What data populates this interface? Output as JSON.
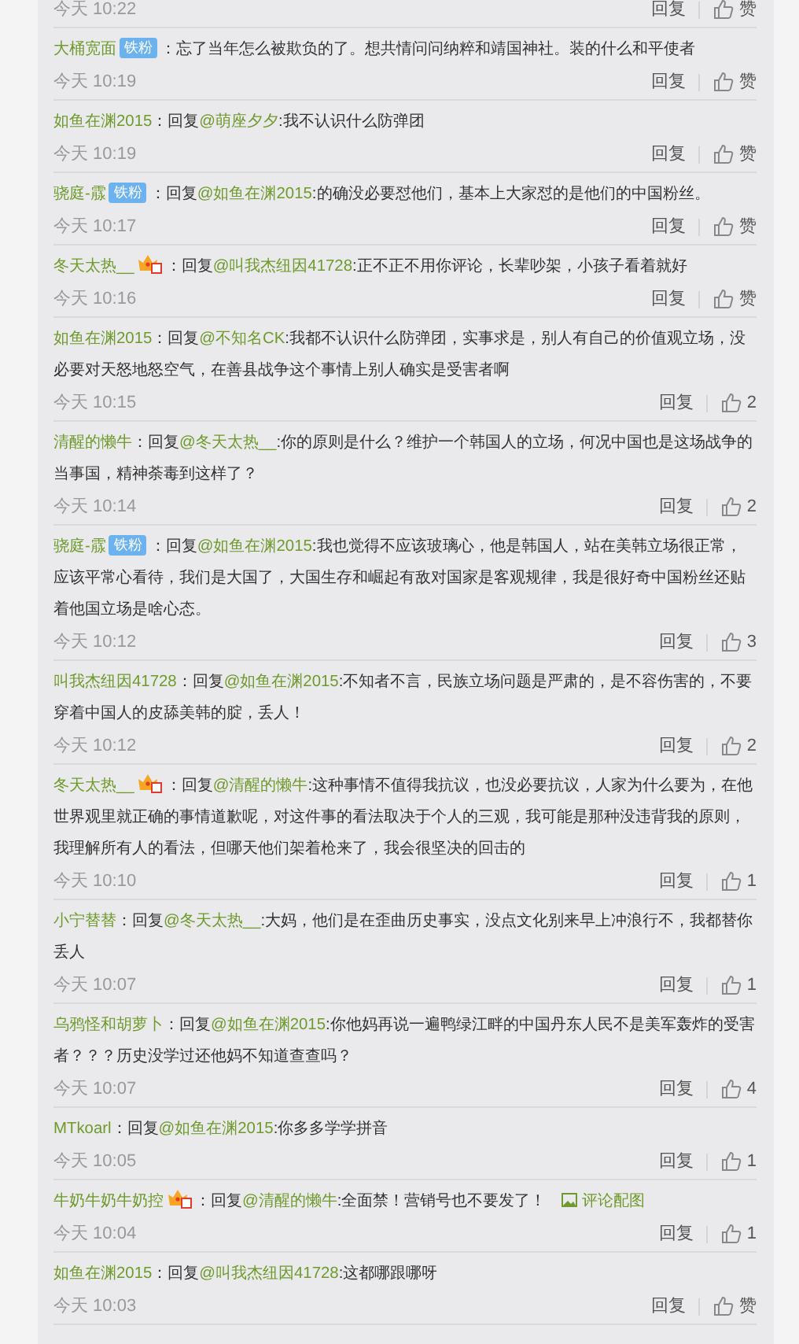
{
  "comments": [
    {
      "time": "今天 10:22",
      "reply": "回复",
      "likes": "赞"
    },
    {
      "user": "大桶宽面",
      "badge": {
        "kind": "fan",
        "text": "铁粉"
      },
      "colon": "：",
      "text": "忘了当年怎么被欺负的了。想共情问问纳粹和靖国神社。装的什么和平使者",
      "time": "今天 10:19",
      "reply": "回复",
      "likes": "赞"
    },
    {
      "user": "如鱼在渊2015",
      "colon": "：",
      "reply_label": "回复",
      "mention": "@萌座夕夕",
      "text": ":我不认识什么防弹团",
      "time": "今天 10:19",
      "reply": "回复",
      "likes": "赞"
    },
    {
      "user": "骁庭-霡",
      "badge": {
        "kind": "fan",
        "text": "铁粉"
      },
      "colon": "：",
      "reply_label": "回复",
      "mention": "@如鱼在渊2015",
      "text": ":的确没必要怼他们，基本上大家怼的是他们的中国粉丝。",
      "time": "今天 10:17",
      "reply": "回复",
      "likes": "赞"
    },
    {
      "user": "冬天太热__",
      "badge": {
        "kind": "crown"
      },
      "colon": "：",
      "reply_label": "回复",
      "mention": "@叫我杰纽因41728",
      "text": ":正不正不用你评论，长辈吵架，小孩子看着就好",
      "time": "今天 10:16",
      "reply": "回复",
      "likes": "赞"
    },
    {
      "user": "如鱼在渊2015",
      "colon": "：",
      "reply_label": "回复",
      "mention": "@不知名CK",
      "text": ":我都不认识什么防弹团，实事求是，别人有自己的价值观立场，没必要对天怒地怒空气，在善县战争这个事情上别人确实是受害者啊",
      "time": "今天 10:15",
      "reply": "回复",
      "likes": "2"
    },
    {
      "user": "清醒的懒牛",
      "colon": "：",
      "reply_label": "回复",
      "mention": "@冬天太热__",
      "text": ":你的原则是什么？维护一个韩国人的立场，何况中国也是这场战争的当事国，精神荼毒到这样了？",
      "time": "今天 10:14",
      "reply": "回复",
      "likes": "2"
    },
    {
      "user": "骁庭-霡",
      "badge": {
        "kind": "fan",
        "text": "铁粉"
      },
      "colon": "：",
      "reply_label": "回复",
      "mention": "@如鱼在渊2015",
      "text": ":我也觉得不应该玻璃心，他是韩国人，站在美韩立场很正常，应该平常心看待，我们是大国了，大国生存和崛起有敌对国家是客观规律，我是很好奇中国粉丝还贴着他国立场是啥心态。",
      "time": "今天 10:12",
      "reply": "回复",
      "likes": "3"
    },
    {
      "user": "叫我杰纽因41728",
      "colon": "：",
      "reply_label": "回复",
      "mention": "@如鱼在渊2015",
      "text": ":不知者不言，民族立场问题是严肃的，是不容伤害的，不要穿着中国人的皮舔美韩的腚，丢人！",
      "time": "今天 10:12",
      "reply": "回复",
      "likes": "2"
    },
    {
      "user": "冬天太热__",
      "badge": {
        "kind": "crown"
      },
      "colon": "：",
      "reply_label": "回复",
      "mention": "@清醒的懒牛",
      "text": ":这种事情不值得我抗议，也没必要抗议，人家为什么要为，在他世界观里就正确的事情道歉呢，对这件事的看法取决于个人的三观，我可能是那种没违背我的原则，我理解所有人的看法，但哪天他们架着枪来了，我会很坚决的回击的",
      "time": "今天 10:10",
      "reply": "回复",
      "likes": "1"
    },
    {
      "user": "小宁替替",
      "colon": "：",
      "reply_label": "回复",
      "mention": "@冬天太热__",
      "text": ":大妈，他们是在歪曲历史事实，没点文化别来早上冲浪行不，我都替你丢人",
      "time": "今天 10:07",
      "reply": "回复",
      "likes": "1"
    },
    {
      "user": "乌鸦怪和胡萝卜",
      "colon": "：",
      "reply_label": "回复",
      "mention": "@如鱼在渊2015",
      "text": ":你他妈再说一遍鸭绿江畔的中国丹东人民不是美军轰炸的受害者？？？历史没学过还他妈不知道查查吗？",
      "time": "今天 10:07",
      "reply": "回复",
      "likes": "4"
    },
    {
      "user": "MTkoarl",
      "colon": "：",
      "reply_label": "回复",
      "mention": "@如鱼在渊2015",
      "text": ":你多多学学拼音",
      "time": "今天 10:05",
      "reply": "回复",
      "likes": "1"
    },
    {
      "user": "牛奶牛奶牛奶控",
      "badge": {
        "kind": "crown"
      },
      "colon": "：",
      "reply_label": "回复",
      "mention": "@清醒的懒牛",
      "text": ":全面禁！营销号也不要发了！",
      "image_link": "评论配图",
      "time": "今天 10:04",
      "reply": "回复",
      "likes": "1"
    },
    {
      "user": "如鱼在渊2015",
      "colon": "：",
      "reply_label": "回复",
      "mention": "@叫我杰纽因41728",
      "text": ":这都哪跟哪呀",
      "time": "今天 10:03",
      "reply": "回复",
      "likes": "赞"
    }
  ]
}
